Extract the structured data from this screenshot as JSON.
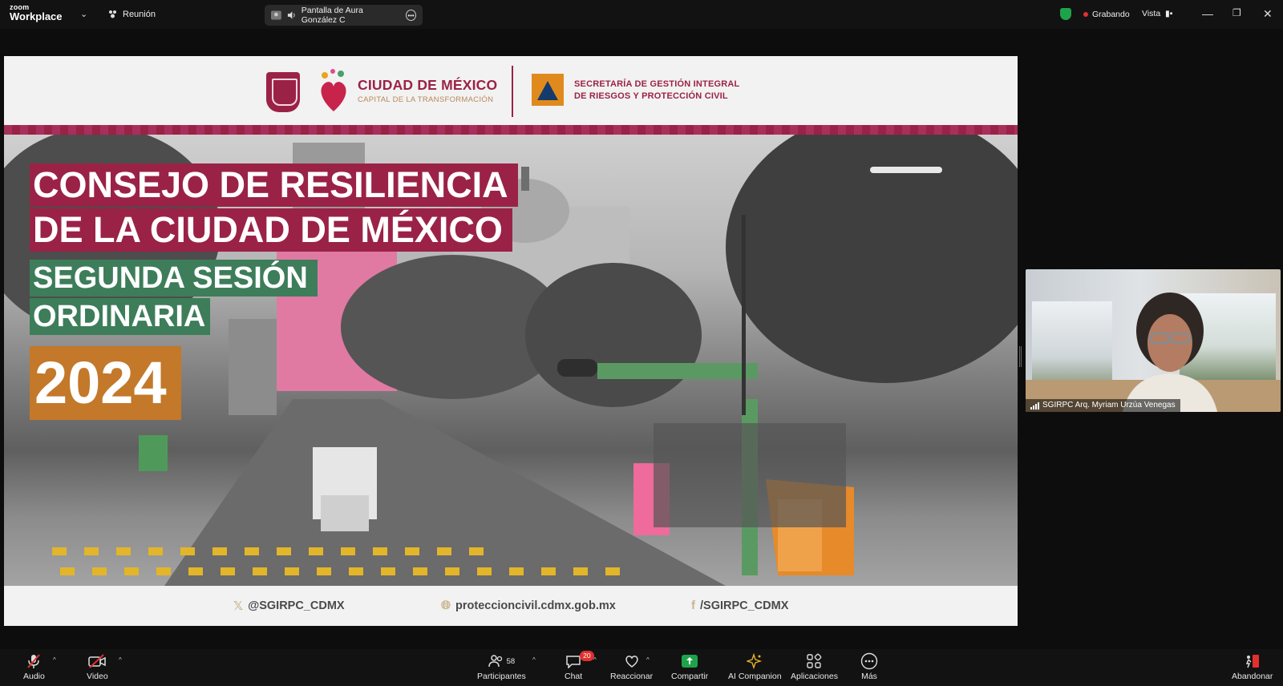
{
  "topbar": {
    "brand_top": "zoom",
    "brand_bottom": "Workplace",
    "meeting_label": "Reunión",
    "share_label": "Pantalla de Aura González C",
    "recording_label": "Grabando",
    "view_label": "Vista"
  },
  "slide": {
    "org_name": "CIUDAD DE MÉXICO",
    "org_tagline": "CAPITAL DE LA TRANSFORMACIÓN",
    "secretariat_line1": "SECRETARÍA DE GESTIÓN INTEGRAL",
    "secretariat_line2": "DE RIESGOS Y PROTECCIÓN CIVIL",
    "title_line1": "CONSEJO DE RESILIENCIA",
    "title_line2": "DE LA CIUDAD DE MÉXICO",
    "subtitle_line1": "SEGUNDA SESIÓN",
    "subtitle_line2": "ORDINARIA",
    "year": "2024",
    "footer": {
      "x_handle": "@SGIRPC_CDMX",
      "website": "proteccioncivil.cdmx.gob.mx",
      "facebook": "/SGIRPC_CDMX"
    }
  },
  "video": {
    "participant_name": "SGIRPC Arq. Myriam Urzúa Venegas"
  },
  "toolbar": {
    "audio": "Audio",
    "video": "Video",
    "participants": "Participantes",
    "participants_count": "58",
    "chat": "Chat",
    "chat_badge": "20",
    "react": "Reaccionar",
    "share": "Compartir",
    "ai": "AI Companion",
    "apps": "Aplicaciones",
    "more": "Más",
    "leave": "Abandonar"
  },
  "colors": {
    "brand_guinda": "#9b2247",
    "green_band": "#3d7d5a",
    "orange_band": "#c3782a",
    "share_green": "#1ea34b",
    "recording_red": "#e0312f"
  }
}
